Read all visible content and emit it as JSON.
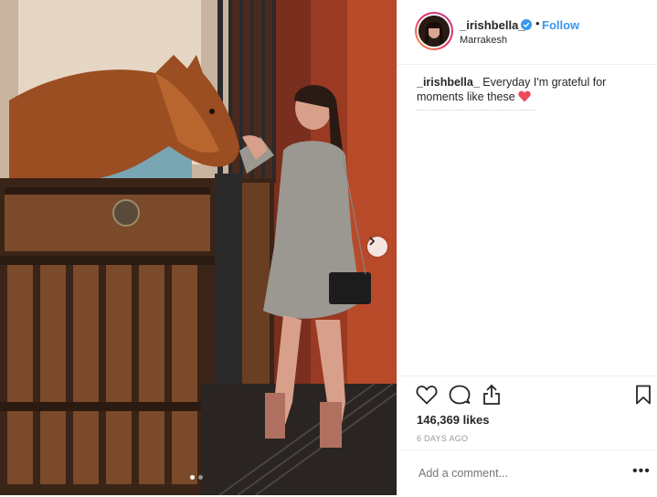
{
  "post": {
    "username": "_irishbella_",
    "separator": "•",
    "follow_label": "Follow",
    "location": "Marrakesh",
    "caption_user": "_irishbella_",
    "caption_text": " Everyday I'm grateful for moments like these",
    "likes": "146,369 likes",
    "time_ago": "6 DAYS AGO",
    "comment_placeholder": "Add a comment...",
    "more_label": "•••"
  },
  "carousel": {
    "count": 2,
    "active": 1
  },
  "colors": {
    "accent": "#3897f0",
    "heart": "#ed4956"
  },
  "icons": [
    "verified-icon",
    "like-icon",
    "comment-icon",
    "share-icon",
    "save-icon",
    "chevron-right-icon"
  ]
}
